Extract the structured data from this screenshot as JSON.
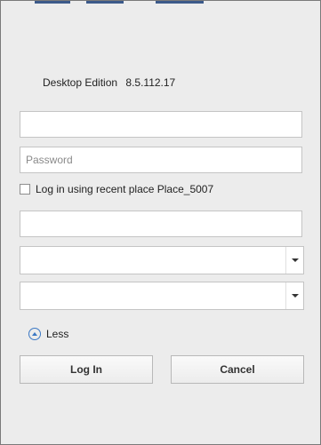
{
  "version": {
    "edition": "Desktop Edition",
    "number": "8.5.112.17"
  },
  "form": {
    "username": {
      "value": "",
      "placeholder": ""
    },
    "password": {
      "value": "",
      "placeholder": "Password"
    },
    "recent_place": {
      "checked": false,
      "label": "Log in using recent place Place_5007"
    },
    "place": {
      "value": "",
      "placeholder": ""
    },
    "select_1": {
      "value": ""
    },
    "select_2": {
      "value": ""
    }
  },
  "toggle": {
    "label": "Less",
    "icon": "collapse-up-icon"
  },
  "buttons": {
    "login": "Log In",
    "cancel": "Cancel"
  },
  "colors": {
    "accent": "#3b78c4",
    "background": "#ececec"
  }
}
